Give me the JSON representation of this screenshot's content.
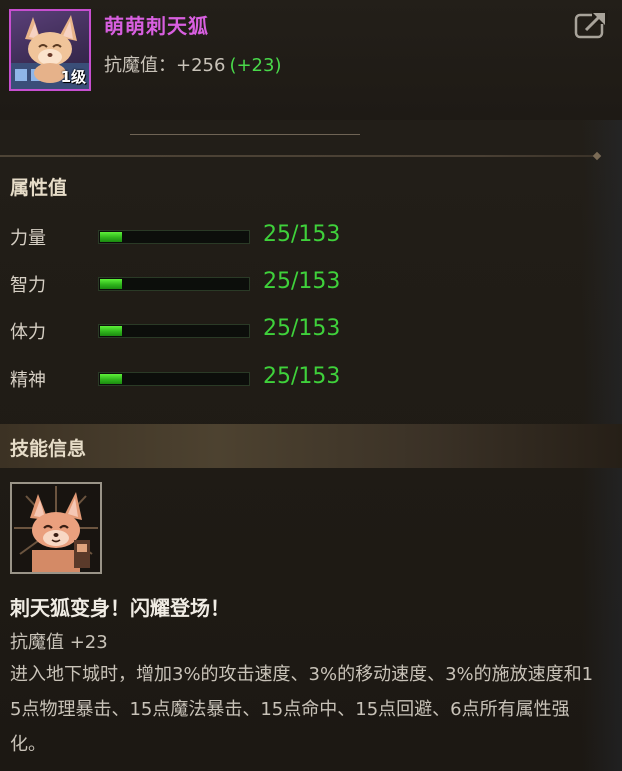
{
  "item": {
    "name": "萌萌刺天狐",
    "level_badge": "1级",
    "stat_label": "抗魔值：",
    "stat_value": "+256",
    "stat_bonus": "(+23)",
    "name_color": "#d85fe0",
    "border_color": "#c74fd0"
  },
  "attributes": {
    "title": "属性值",
    "rows": [
      {
        "label": "力量",
        "value": "25/153",
        "fill": 0.163
      },
      {
        "label": "智力",
        "value": "25/153",
        "fill": 0.163
      },
      {
        "label": "体力",
        "value": "25/153",
        "fill": 0.163
      },
      {
        "label": "精神",
        "value": "25/153",
        "fill": 0.163
      }
    ],
    "bar_color": "#3fd13b"
  },
  "skill": {
    "section_title": "技能信息",
    "name": "刺天狐变身！闪耀登场！",
    "stat": "抗魔值 +23",
    "description": "进入地下城时，增加3%的攻击速度、3%的移动速度、3%的施放速度和15点物理暴击、15点魔法暴击、15点命中、15点回避、6点所有属性强化。"
  },
  "icons": {
    "share": "share-icon",
    "portrait": "fox-portrait-icon",
    "skill": "fox-skill-icon"
  }
}
